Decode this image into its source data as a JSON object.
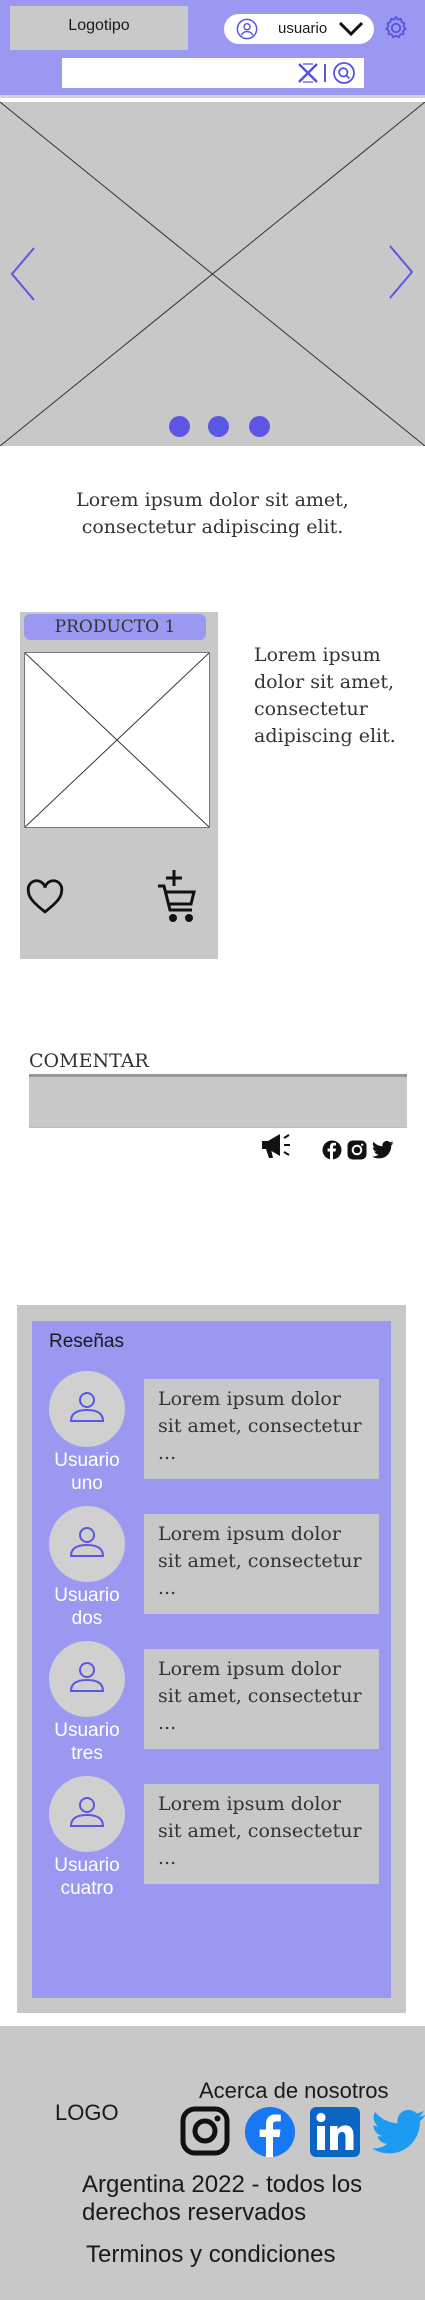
{
  "colors": {
    "accent": "#9b98f2",
    "accent_dark": "#5b56e4",
    "panel": "#c8c8c8"
  },
  "header": {
    "logo_text": "Logotipo",
    "user_name": "usuario",
    "search_placeholder": "",
    "icons": [
      "user-circle-icon",
      "chevron-down-icon",
      "gear-icon",
      "clear-icon",
      "search-icon"
    ]
  },
  "carousel": {
    "slide_count": 3,
    "icons": [
      "chevron-left-icon",
      "chevron-right-icon"
    ]
  },
  "intro": {
    "line1": "Lorem ipsum dolor sit amet,",
    "line2": "consectetur adipiscing elit."
  },
  "product": {
    "title": "PRODUCTO 1",
    "description": "Lorem ipsum dolor sit amet, consectetur adipiscing elit.",
    "icons": [
      "heart-icon",
      "add-to-cart-icon"
    ]
  },
  "comments": {
    "label": "COMENTAR",
    "placeholder": "",
    "icons": [
      "megaphone-icon",
      "facebook-icon",
      "instagram-icon",
      "twitter-icon"
    ]
  },
  "reviews": {
    "title": "Reseñas",
    "items": [
      {
        "user": "Usuario uno",
        "text": "Lorem ipsum dolor sit amet, consectetur ..."
      },
      {
        "user": "Usuario dos",
        "text": "Lorem ipsum dolor sit amet, consectetur ..."
      },
      {
        "user": "Usuario tres",
        "text": "Lorem ipsum dolor sit amet, consectetur ..."
      },
      {
        "user": "Usuario cuatro",
        "text": "Lorem ipsum dolor sit amet, consectetur ..."
      }
    ]
  },
  "footer": {
    "logo_text": "LOGO",
    "about_label": "Acerca de nosotros",
    "copyright": "Argentina 2022 - todos los derechos reservados",
    "terms_label": "Terminos y condiciones",
    "social_icons": [
      "instagram-icon",
      "facebook-icon",
      "linkedin-icon",
      "twitter-icon"
    ]
  }
}
